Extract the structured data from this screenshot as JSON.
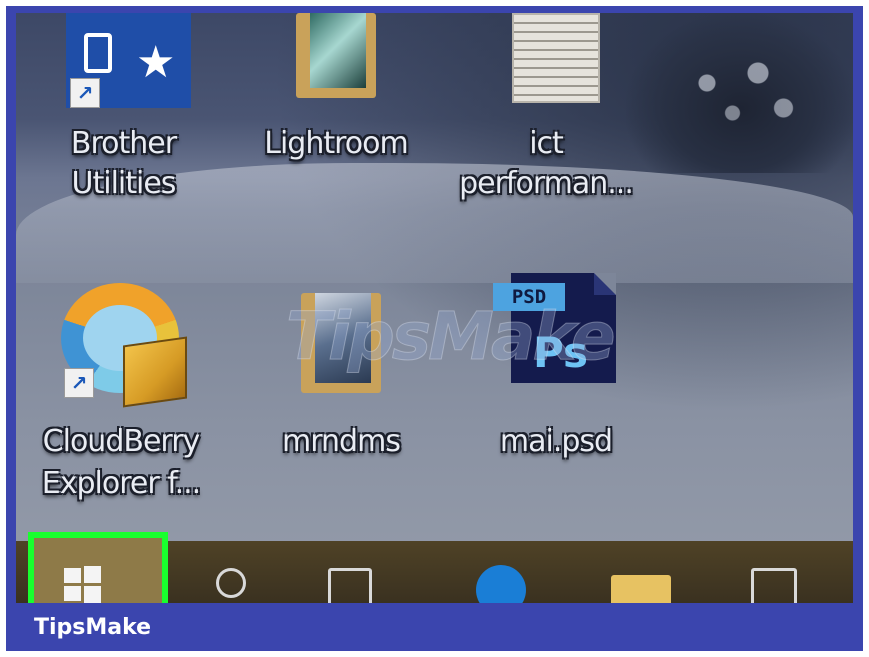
{
  "desktop": {
    "icons": [
      {
        "label_line1": "Brother",
        "label_line2": "Utilities"
      },
      {
        "label_line1": "Lightroom",
        "label_line2": ""
      },
      {
        "label_line1": "ict",
        "label_line2": "performan..."
      },
      {
        "label_line1": "CloudBerry",
        "label_line2": "Explorer f..."
      },
      {
        "label_line1": "mrndms",
        "label_line2": ""
      },
      {
        "label_line1": "mai.psd",
        "label_line2": ""
      }
    ],
    "psd_badge": "PSD",
    "psd_mark": "Ps",
    "watermark": "TipsMake"
  },
  "taskbar": {
    "items": [
      "start-button",
      "search",
      "task-view",
      "edge",
      "file-explorer",
      "store"
    ],
    "highlight_color": "#19ff2e"
  },
  "footer": {
    "brand": "TipsMake"
  },
  "colors": {
    "frame": "#3b45ae",
    "taskbar": "#4f4226"
  }
}
